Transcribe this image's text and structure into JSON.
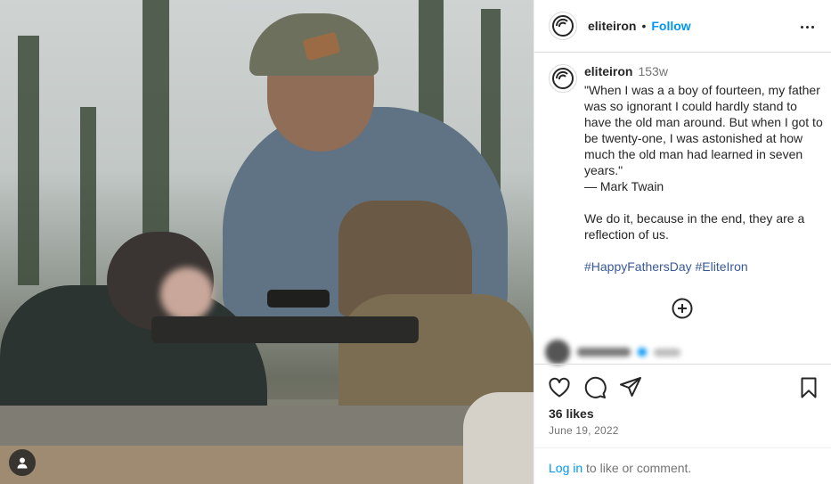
{
  "post": {
    "username": "eliteiron",
    "follow_label": "Follow",
    "separator": "•"
  },
  "caption": {
    "username": "eliteiron",
    "time": "153w",
    "text": "\"When I was a a boy of fourteen, my father was so ignorant I could hardly stand to have the old man around. But when I got to be twenty-one, I was astonished at how much the old man had learned in seven years.\"\n— Mark Twain\n\nWe do it, because in the end, they are a reflection of us.",
    "hashtags": [
      "#HappyFathersDay",
      "#EliteIron"
    ]
  },
  "engagement": {
    "likes": "36 likes",
    "date": "June 19, 2022"
  },
  "login": {
    "link": "Log in",
    "suffix": " to like or comment."
  },
  "icons": {
    "more": "more-options-icon",
    "like": "heart-icon",
    "comment": "comment-icon",
    "share": "share-icon",
    "save": "bookmark-icon",
    "load_more": "plus-circle-icon",
    "tag": "user-tag-icon"
  },
  "colors": {
    "accent": "#0095f6",
    "text": "#262626",
    "muted": "#737373",
    "hashtag": "#385898"
  }
}
